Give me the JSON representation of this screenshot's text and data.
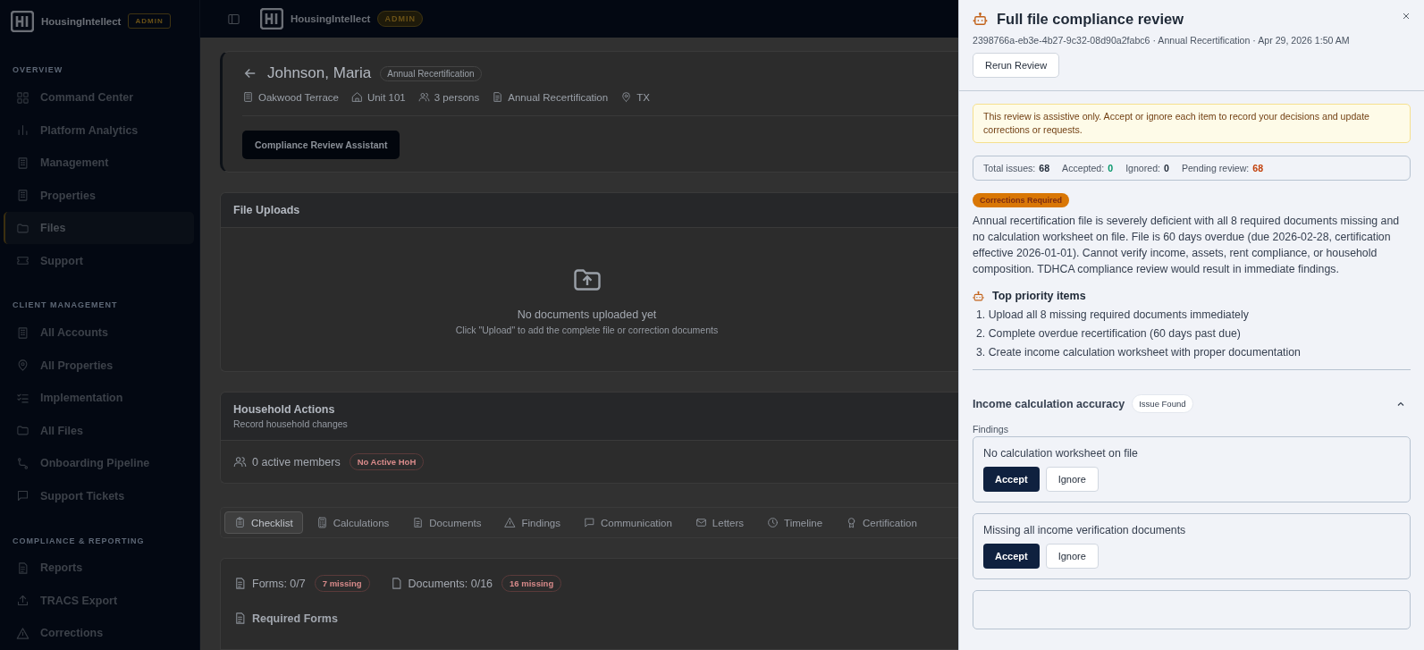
{
  "sidebar": {
    "brand": "HousingIntellect",
    "badge": "ADMIN",
    "sections": [
      {
        "title": "OVERVIEW",
        "items": [
          {
            "label": "Command Center",
            "selected": false
          },
          {
            "label": "Platform Analytics",
            "selected": false
          },
          {
            "label": "Management",
            "selected": false
          },
          {
            "label": "Properties",
            "selected": false
          },
          {
            "label": "Files",
            "selected": true
          },
          {
            "label": "Support",
            "selected": false
          }
        ]
      },
      {
        "title": "CLIENT MANAGEMENT",
        "items": [
          {
            "label": "All Accounts",
            "selected": false
          },
          {
            "label": "All Properties",
            "selected": false
          },
          {
            "label": "Implementation",
            "selected": false
          },
          {
            "label": "All Files",
            "selected": false
          },
          {
            "label": "Onboarding Pipeline",
            "selected": false
          },
          {
            "label": "Support Tickets",
            "selected": false
          }
        ]
      },
      {
        "title": "COMPLIANCE & REPORTING",
        "items": [
          {
            "label": "Reports",
            "selected": false
          },
          {
            "label": "TRACS Export",
            "selected": false
          },
          {
            "label": "Corrections",
            "selected": false
          }
        ]
      }
    ]
  },
  "topbar": {
    "brand": "HousingIntellect",
    "badge": "ADMIN"
  },
  "household": {
    "name": "Johnson, Maria",
    "type_badge": "Annual Recertification",
    "meta": [
      "Oakwood Terrace",
      "Unit 101",
      "3 persons",
      "Annual Recertification",
      "TX"
    ],
    "assistant_button": "Compliance Review Assistant"
  },
  "file_uploads": {
    "title": "File Uploads",
    "empty_title": "No documents uploaded yet",
    "empty_hint": "Click \"Upload\" to add the complete file or correction documents"
  },
  "household_actions": {
    "title": "Household Actions",
    "subtitle": "Record household changes",
    "members": "0 active members",
    "warning": "No Active HoH"
  },
  "tabs": [
    {
      "label": "Checklist",
      "selected": true
    },
    {
      "label": "Calculations",
      "selected": false
    },
    {
      "label": "Documents",
      "selected": false
    },
    {
      "label": "Findings",
      "selected": false
    },
    {
      "label": "Communication",
      "selected": false
    },
    {
      "label": "Letters",
      "selected": false
    },
    {
      "label": "Timeline",
      "selected": false
    },
    {
      "label": "Certification",
      "selected": false
    }
  ],
  "checklist": {
    "forms": "Forms: 0/7",
    "forms_missing": "7 missing",
    "documents": "Documents: 0/16",
    "documents_missing": "16 missing",
    "required_forms": "Required Forms"
  },
  "review": {
    "title": "Full file compliance review",
    "meta": "2398766a-eb3e-4b27-9c32-08d90a2fabc6 · Annual Recertification · Apr 29, 2026 1:50 AM",
    "rerun_button": "Rerun Review",
    "notice": "This review is assistive only. Accept or ignore each item to record your decisions and update corrections or requests.",
    "stats": [
      {
        "label": "Total issues:",
        "value": "68",
        "color": "#1f2937"
      },
      {
        "label": "Accepted:",
        "value": "0",
        "color": "#059669"
      },
      {
        "label": "Ignored:",
        "value": "0",
        "color": "#1f2937"
      },
      {
        "label": "Pending review:",
        "value": "68",
        "color": "#c2410c"
      }
    ],
    "status_badge": "Corrections Required",
    "summary": "Annual recertification file is severely deficient with all 8 required documents missing and no calculation worksheet on file. File is 60 days overdue (due 2026-02-28, certification effective 2026-01-01). Cannot verify income, assets, rent compliance, or household composition. TDHCA compliance review would result in immediate findings.",
    "priority_title": "Top priority items",
    "priority_items": [
      "1. Upload all 8 missing required documents immediately",
      "2. Complete overdue recertification (60 days past due)",
      "3. Create income calculation worksheet with proper documentation"
    ],
    "section": {
      "title": "Income calculation accuracy",
      "badge": "Issue Found",
      "expanded": true,
      "findings_label": "Findings",
      "findings": [
        {
          "text": "No calculation worksheet on file",
          "accept": "Accept",
          "ignore": "Ignore"
        },
        {
          "text": "Missing all income verification documents",
          "accept": "Accept",
          "ignore": "Ignore"
        }
      ]
    }
  }
}
